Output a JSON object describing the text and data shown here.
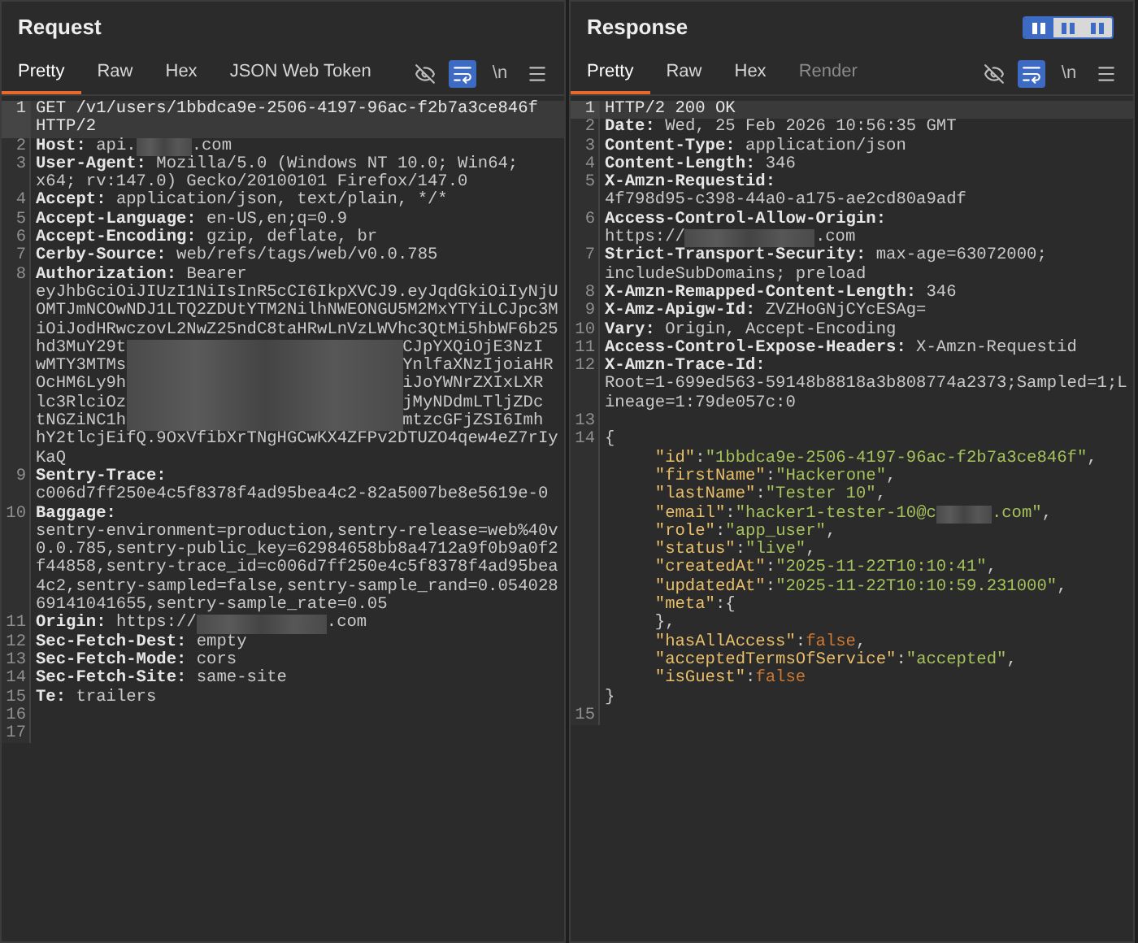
{
  "view_toggle": [
    {
      "selected": true
    },
    {
      "selected": false
    },
    {
      "selected": false
    }
  ],
  "panes": [
    {
      "title": "Request",
      "tabs": [
        {
          "label": "Pretty",
          "selected": true,
          "disabled": false
        },
        {
          "label": "Raw",
          "selected": false,
          "disabled": false
        },
        {
          "label": "Hex",
          "selected": false,
          "disabled": false
        },
        {
          "label": "JSON Web Token",
          "selected": false,
          "disabled": false
        }
      ],
      "toolbar": [
        {
          "kind": "eye",
          "on": false
        },
        {
          "kind": "wrap",
          "on": true
        },
        {
          "kind": "newline",
          "label": "\\n",
          "on": false
        },
        {
          "kind": "menu",
          "on": false
        }
      ],
      "lines": [
        {
          "number": "1",
          "current": true,
          "rows": [
            {
              "spans": [
                {
                  "kind": "plain",
                  "text": "GET /v1/users/1bbdca9e-2506-4197-96ac-f2b7a3ce846f"
                }
              ]
            },
            {
              "spans": [
                {
                  "kind": "plain",
                  "text": "HTTP/2"
                }
              ]
            }
          ]
        },
        {
          "number": "2",
          "current": false,
          "rows": [
            {
              "spans": [
                {
                  "kind": "name",
                  "text": "Host:"
                },
                {
                  "kind": "value",
                  "text": " api."
                },
                {
                  "kind": "redacted-short"
                },
                {
                  "kind": "value",
                  "text": ".com"
                }
              ]
            }
          ]
        },
        {
          "number": "3",
          "current": false,
          "rows": [
            {
              "spans": [
                {
                  "kind": "name",
                  "text": "User-Agent:"
                },
                {
                  "kind": "value",
                  "text": " Mozilla/5.0 (Windows NT 10.0; Win64;"
                }
              ]
            },
            {
              "spans": [
                {
                  "kind": "value",
                  "text": "x64; rv:147.0) Gecko/20100101 Firefox/147.0"
                }
              ]
            }
          ]
        },
        {
          "number": "4",
          "current": false,
          "rows": [
            {
              "spans": [
                {
                  "kind": "name",
                  "text": "Accept:"
                },
                {
                  "kind": "value",
                  "text": " application/json, text/plain, */*"
                }
              ]
            }
          ]
        },
        {
          "number": "5",
          "current": false,
          "rows": [
            {
              "spans": [
                {
                  "kind": "name",
                  "text": "Accept-Language:"
                },
                {
                  "kind": "value",
                  "text": " en-US,en;q=0.9"
                }
              ]
            }
          ]
        },
        {
          "number": "6",
          "current": false,
          "rows": [
            {
              "spans": [
                {
                  "kind": "name",
                  "text": "Accept-Encoding:"
                },
                {
                  "kind": "value",
                  "text": " gzip, deflate, br"
                }
              ]
            }
          ]
        },
        {
          "number": "7",
          "current": false,
          "rows": [
            {
              "spans": [
                {
                  "kind": "name",
                  "text": "Cerby-Source:"
                },
                {
                  "kind": "value",
                  "text": " web/refs/tags/web/v0.0.785"
                }
              ]
            }
          ]
        },
        {
          "number": "8",
          "current": false,
          "rows": [
            {
              "spans": [
                {
                  "kind": "name",
                  "text": "Authorization:"
                },
                {
                  "kind": "value",
                  "text": " Bearer"
                }
              ]
            },
            {
              "spans": [
                {
                  "kind": "value",
                  "text": "eyJhbGciOiJIUzI1NiIsInR5cCI6IkpXVCJ9.eyJqdGkiOiIyNjU"
                }
              ]
            },
            {
              "spans": [
                {
                  "kind": "value",
                  "text": "OMTJmNCOwNDJ1LTQ2ZDUtYTM2NilhNWEONGU5M2MxYTYiLCJpc3M"
                }
              ]
            },
            {
              "spans": [
                {
                  "kind": "value",
                  "text": "iOiJodHRwczovL2NwZ25ndC8taHRwLnVzLWVhc3QtMi5hbWF6b25"
                }
              ]
            },
            {
              "spans": [
                {
                  "kind": "value",
                  "text": "hd3MuY29t"
                },
                {
                  "kind": "redacted-long"
                },
                {
                  "kind": "value",
                  "text": "CJpYXQiOjE3NzI"
                }
              ]
            },
            {
              "spans": [
                {
                  "kind": "value",
                  "text": "wMTY3MTMs"
                },
                {
                  "kind": "redacted-long"
                },
                {
                  "kind": "value",
                  "text": "YnlfaXNzIjoiaHR"
                }
              ]
            },
            {
              "spans": [
                {
                  "kind": "value",
                  "text": "OcHM6Ly9h"
                },
                {
                  "kind": "redacted-long"
                },
                {
                  "kind": "value",
                  "text": "iJoYWNrZXIxLXR"
                }
              ]
            },
            {
              "spans": [
                {
                  "kind": "value",
                  "text": "lc3RlciOz"
                },
                {
                  "kind": "redacted-long"
                },
                {
                  "kind": "value",
                  "text": "jMyNDdmLTljZDc"
                }
              ]
            },
            {
              "spans": [
                {
                  "kind": "value",
                  "text": "tNGZiNC1h"
                },
                {
                  "kind": "redacted-long"
                },
                {
                  "kind": "value",
                  "text": "mtzcGFjZSI6Imh"
                }
              ]
            },
            {
              "spans": [
                {
                  "kind": "value",
                  "text": "hY2tlcjEifQ.9OxVfibXrTNgHGCwKX4ZFPv2DTUZO4qew4eZ7rIy"
                }
              ]
            },
            {
              "spans": [
                {
                  "kind": "value",
                  "text": "KaQ"
                }
              ]
            }
          ]
        },
        {
          "number": "9",
          "current": false,
          "rows": [
            {
              "spans": [
                {
                  "kind": "name",
                  "text": "Sentry-Trace:"
                }
              ]
            },
            {
              "spans": [
                {
                  "kind": "value",
                  "text": "c006d7ff250e4c5f8378f4ad95bea4c2-82a5007be8e5619e-0"
                }
              ]
            }
          ]
        },
        {
          "number": "10",
          "current": false,
          "rows": [
            {
              "spans": [
                {
                  "kind": "name",
                  "text": "Baggage:"
                }
              ]
            },
            {
              "spans": [
                {
                  "kind": "value",
                  "text": "sentry-environment=production,sentry-release=web%40v"
                }
              ]
            },
            {
              "spans": [
                {
                  "kind": "value",
                  "text": "0.0.785,sentry-public_key=62984658bb8a4712a9f0b9a0f2"
                }
              ]
            },
            {
              "spans": [
                {
                  "kind": "value",
                  "text": "f44858,sentry-trace_id=c006d7ff250e4c5f8378f4ad95bea"
                }
              ]
            },
            {
              "spans": [
                {
                  "kind": "value",
                  "text": "4c2,sentry-sampled=false,sentry-sample_rand=0.054028"
                }
              ]
            },
            {
              "spans": [
                {
                  "kind": "value",
                  "text": "69141041655,sentry-sample_rate=0.05"
                }
              ]
            }
          ]
        },
        {
          "number": "11",
          "current": false,
          "rows": [
            {
              "spans": [
                {
                  "kind": "name",
                  "text": "Origin:"
                },
                {
                  "kind": "value",
                  "text": " https://"
                },
                {
                  "kind": "redacted-medium"
                },
                {
                  "kind": "value",
                  "text": ".com"
                }
              ]
            }
          ]
        },
        {
          "number": "12",
          "current": false,
          "rows": [
            {
              "spans": [
                {
                  "kind": "name",
                  "text": "Sec-Fetch-Dest:"
                },
                {
                  "kind": "value",
                  "text": " empty"
                }
              ]
            }
          ]
        },
        {
          "number": "13",
          "current": false,
          "rows": [
            {
              "spans": [
                {
                  "kind": "name",
                  "text": "Sec-Fetch-Mode:"
                },
                {
                  "kind": "value",
                  "text": " cors"
                }
              ]
            }
          ]
        },
        {
          "number": "14",
          "current": false,
          "rows": [
            {
              "spans": [
                {
                  "kind": "name",
                  "text": "Sec-Fetch-Site:"
                },
                {
                  "kind": "value",
                  "text": " same-site"
                }
              ]
            }
          ]
        },
        {
          "number": "15",
          "current": false,
          "rows": [
            {
              "spans": [
                {
                  "kind": "name",
                  "text": "Te:"
                },
                {
                  "kind": "value",
                  "text": " trailers"
                }
              ]
            }
          ]
        },
        {
          "number": "16",
          "current": false
        },
        {
          "number": "17",
          "current": false
        }
      ]
    },
    {
      "title": "Response",
      "tabs": [
        {
          "label": "Pretty",
          "selected": true,
          "disabled": false
        },
        {
          "label": "Raw",
          "selected": false,
          "disabled": false
        },
        {
          "label": "Hex",
          "selected": false,
          "disabled": false
        },
        {
          "label": "Render",
          "selected": false,
          "disabled": true
        }
      ],
      "toolbar": [
        {
          "kind": "eye",
          "on": false
        },
        {
          "kind": "wrap",
          "on": true
        },
        {
          "kind": "newline",
          "label": "\\n",
          "on": false
        },
        {
          "kind": "menu",
          "on": false
        }
      ],
      "lines": [
        {
          "number": "1",
          "current": true,
          "rows": [
            {
              "spans": [
                {
                  "kind": "plain",
                  "text": "HTTP/2 200 OK"
                }
              ]
            }
          ]
        },
        {
          "number": "2",
          "current": false,
          "rows": [
            {
              "spans": [
                {
                  "kind": "name",
                  "text": "Date:"
                },
                {
                  "kind": "value",
                  "text": " Wed, 25 Feb 2026 10:56:35 GMT"
                }
              ]
            }
          ]
        },
        {
          "number": "3",
          "current": false,
          "rows": [
            {
              "spans": [
                {
                  "kind": "name",
                  "text": "Content-Type:"
                },
                {
                  "kind": "value",
                  "text": " application/json"
                }
              ]
            }
          ]
        },
        {
          "number": "4",
          "current": false,
          "rows": [
            {
              "spans": [
                {
                  "kind": "name",
                  "text": "Content-Length:"
                },
                {
                  "kind": "value",
                  "text": " 346"
                }
              ]
            }
          ]
        },
        {
          "number": "5",
          "current": false,
          "rows": [
            {
              "spans": [
                {
                  "kind": "name",
                  "text": "X-Amzn-Requestid:"
                }
              ]
            },
            {
              "spans": [
                {
                  "kind": "value",
                  "text": "4f798d95-c398-44a0-a175-ae2cd80a9adf"
                }
              ]
            }
          ]
        },
        {
          "number": "6",
          "current": false,
          "rows": [
            {
              "spans": [
                {
                  "kind": "name",
                  "text": "Access-Control-Allow-Origin:"
                }
              ]
            },
            {
              "spans": [
                {
                  "kind": "value",
                  "text": "https://"
                },
                {
                  "kind": "redacted-medium"
                },
                {
                  "kind": "value",
                  "text": ".com"
                }
              ]
            }
          ]
        },
        {
          "number": "7",
          "current": false,
          "rows": [
            {
              "spans": [
                {
                  "kind": "name",
                  "text": "Strict-Transport-Security:"
                },
                {
                  "kind": "value",
                  "text": " max-age=63072000;"
                }
              ]
            },
            {
              "spans": [
                {
                  "kind": "value",
                  "text": "includeSubDomains; preload"
                }
              ]
            }
          ]
        },
        {
          "number": "8",
          "current": false,
          "rows": [
            {
              "spans": [
                {
                  "kind": "name",
                  "text": "X-Amzn-Remapped-Content-Length:"
                },
                {
                  "kind": "value",
                  "text": " 346"
                }
              ]
            }
          ]
        },
        {
          "number": "9",
          "current": false,
          "rows": [
            {
              "spans": [
                {
                  "kind": "name",
                  "text": "X-Amz-Apigw-Id:"
                },
                {
                  "kind": "value",
                  "text": " ZVZHoGNjCYcESAg="
                }
              ]
            }
          ]
        },
        {
          "number": "10",
          "current": false,
          "rows": [
            {
              "spans": [
                {
                  "kind": "name",
                  "text": "Vary:"
                },
                {
                  "kind": "value",
                  "text": " Origin, Accept-Encoding"
                }
              ]
            }
          ]
        },
        {
          "number": "11",
          "current": false,
          "rows": [
            {
              "spans": [
                {
                  "kind": "name",
                  "text": "Access-Control-Expose-Headers:"
                },
                {
                  "kind": "value",
                  "text": " X-Amzn-Requestid"
                }
              ]
            }
          ]
        },
        {
          "number": "12",
          "current": false,
          "rows": [
            {
              "spans": [
                {
                  "kind": "name",
                  "text": "X-Amzn-Trace-Id:"
                }
              ]
            },
            {
              "spans": [
                {
                  "kind": "value",
                  "text": "Root=1-699ed563-59148b8818a3b808774a2373;Sampled=1;L"
                }
              ]
            },
            {
              "spans": [
                {
                  "kind": "value",
                  "text": "ineage=1:79de057c:0"
                }
              ]
            }
          ]
        },
        {
          "number": "13",
          "current": false
        },
        {
          "number": "14",
          "current": false,
          "rows": [
            {
              "spans": [
                {
                  "kind": "punct",
                  "text": "{"
                }
              ]
            },
            {
              "spans": [
                {
                  "kind": "key",
                  "text": "     \"id\""
                },
                {
                  "kind": "punct",
                  "text": ":"
                },
                {
                  "kind": "string",
                  "text": "\"1bbdca9e-2506-4197-96ac-f2b7a3ce846f\""
                },
                {
                  "kind": "punct",
                  "text": ","
                }
              ]
            },
            {
              "spans": [
                {
                  "kind": "key",
                  "text": "     \"firstName\""
                },
                {
                  "kind": "punct",
                  "text": ":"
                },
                {
                  "kind": "string",
                  "text": "\"Hackerone\""
                },
                {
                  "kind": "punct",
                  "text": ","
                }
              ]
            },
            {
              "spans": [
                {
                  "kind": "key",
                  "text": "     \"lastName\""
                },
                {
                  "kind": "punct",
                  "text": ":"
                },
                {
                  "kind": "string",
                  "text": "\"Tester 10\""
                },
                {
                  "kind": "punct",
                  "text": ","
                }
              ]
            },
            {
              "spans": [
                {
                  "kind": "key",
                  "text": "     \"email\""
                },
                {
                  "kind": "punct",
                  "text": ":"
                },
                {
                  "kind": "string",
                  "text": "\"hacker1-tester-10@c"
                },
                {
                  "kind": "redacted-short"
                },
                {
                  "kind": "string",
                  "text": ".com\""
                },
                {
                  "kind": "punct",
                  "text": ","
                }
              ]
            },
            {
              "spans": [
                {
                  "kind": "key",
                  "text": "     \"role\""
                },
                {
                  "kind": "punct",
                  "text": ":"
                },
                {
                  "kind": "string",
                  "text": "\"app_user\""
                },
                {
                  "kind": "punct",
                  "text": ","
                }
              ]
            },
            {
              "spans": [
                {
                  "kind": "key",
                  "text": "     \"status\""
                },
                {
                  "kind": "punct",
                  "text": ":"
                },
                {
                  "kind": "string",
                  "text": "\"live\""
                },
                {
                  "kind": "punct",
                  "text": ","
                }
              ]
            },
            {
              "spans": [
                {
                  "kind": "key",
                  "text": "     \"createdAt\""
                },
                {
                  "kind": "punct",
                  "text": ":"
                },
                {
                  "kind": "string",
                  "text": "\"2025-11-22T10:10:41\""
                },
                {
                  "kind": "punct",
                  "text": ","
                }
              ]
            },
            {
              "spans": [
                {
                  "kind": "key",
                  "text": "     \"updatedAt\""
                },
                {
                  "kind": "punct",
                  "text": ":"
                },
                {
                  "kind": "string",
                  "text": "\"2025-11-22T10:10:59.231000\""
                },
                {
                  "kind": "punct",
                  "text": ","
                }
              ]
            },
            {
              "spans": [
                {
                  "kind": "key",
                  "text": "     \"meta\""
                },
                {
                  "kind": "punct",
                  "text": ":{"
                }
              ]
            },
            {
              "spans": [
                {
                  "kind": "punct",
                  "text": "     },"
                }
              ]
            },
            {
              "spans": [
                {
                  "kind": "key",
                  "text": "     \"hasAllAccess\""
                },
                {
                  "kind": "punct",
                  "text": ":"
                },
                {
                  "kind": "literal",
                  "text": "false"
                },
                {
                  "kind": "punct",
                  "text": ","
                }
              ]
            },
            {
              "spans": [
                {
                  "kind": "key",
                  "text": "     \"acceptedTermsOfService\""
                },
                {
                  "kind": "punct",
                  "text": ":"
                },
                {
                  "kind": "string",
                  "text": "\"accepted\""
                },
                {
                  "kind": "punct",
                  "text": ","
                }
              ]
            },
            {
              "spans": [
                {
                  "kind": "key",
                  "text": "     \"isGuest\""
                },
                {
                  "kind": "punct",
                  "text": ":"
                },
                {
                  "kind": "literal",
                  "text": "false"
                }
              ]
            },
            {
              "spans": [
                {
                  "kind": "punct",
                  "text": "}"
                }
              ]
            }
          ]
        },
        {
          "number": "15",
          "current": false
        }
      ]
    }
  ]
}
